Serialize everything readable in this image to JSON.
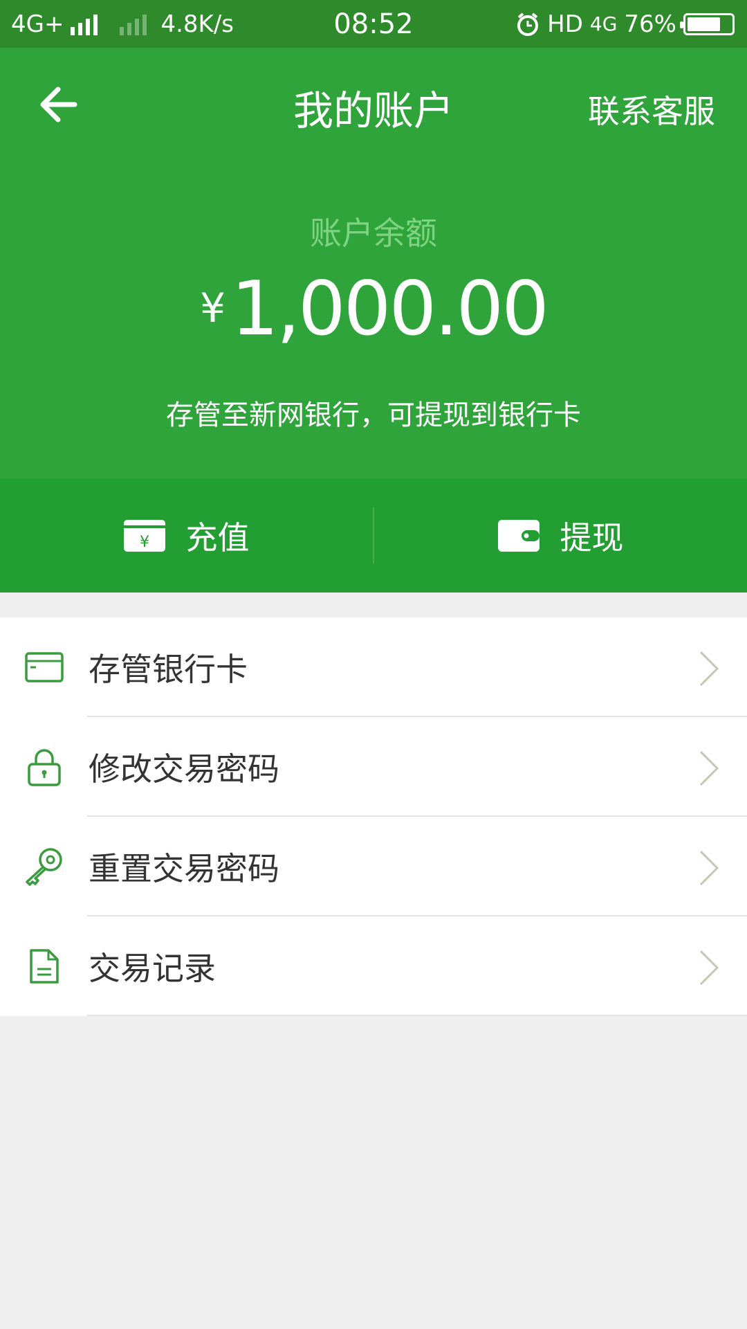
{
  "status_bar": {
    "network": "4G+",
    "speed": "4.8K/s",
    "time": "08:52",
    "hd": "HD",
    "network2": "4G",
    "battery": "76%",
    "battery_level": 0.76
  },
  "header": {
    "title": "我的账户",
    "contact": "联系客服",
    "balance_label": "账户余额",
    "currency": "¥",
    "balance": "1,000.00",
    "note": "存管至新网银行，可提现到银行卡"
  },
  "actions": {
    "recharge": "充值",
    "withdraw": "提现"
  },
  "menu": [
    {
      "label": "存管银行卡",
      "icon": "bank-card-icon"
    },
    {
      "label": "修改交易密码",
      "icon": "lock-icon"
    },
    {
      "label": "重置交易密码",
      "icon": "key-icon"
    },
    {
      "label": "交易记录",
      "icon": "document-icon"
    }
  ],
  "colors": {
    "primary": "#2ea43b",
    "action_bar": "#239e33",
    "status_bar": "#2f8a2c",
    "icon_green": "#3a9b3f"
  }
}
